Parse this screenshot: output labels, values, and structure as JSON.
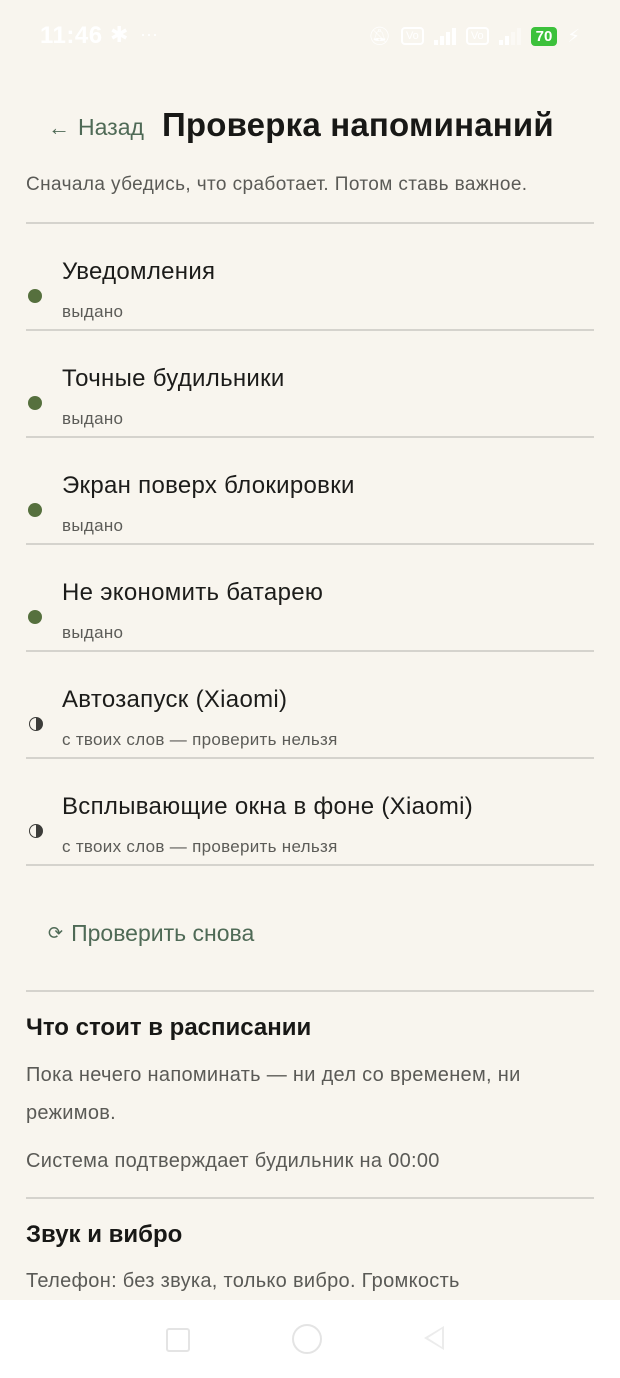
{
  "status_bar": {
    "time": "11:46",
    "battery": "70"
  },
  "header": {
    "back_label": "Назад",
    "title": "Проверка напоминаний",
    "subtitle": "Сначала убедись, что сработает. Потом ставь важное."
  },
  "permissions": [
    {
      "title": "Уведомления",
      "state": "выдано",
      "status": "granted"
    },
    {
      "title": "Точные будильники",
      "state": "выдано",
      "status": "granted"
    },
    {
      "title": "Экран поверх блокировки",
      "state": "выдано",
      "status": "granted"
    },
    {
      "title": "Не экономить батарею",
      "state": "выдано",
      "status": "granted"
    },
    {
      "title": "Автозапуск (Xiaomi)",
      "state": "с твоих слов — проверить нельзя",
      "status": "unverified"
    },
    {
      "title": "Всплывающие окна в фоне (Xiaomi)",
      "state": "с твоих слов — проверить нельзя",
      "status": "unverified"
    }
  ],
  "recheck_label": "Проверить снова",
  "schedule": {
    "title": "Что стоит в расписании",
    "empty_text": "Пока нечего напоминать — ни дел со временем, ни режимов.",
    "alarm_text": "Система подтверждает будильник на 00:00"
  },
  "sound": {
    "title": "Звук и вибро",
    "text": "Телефон: без звука, только вибро. Громкость"
  },
  "colors": {
    "background": "#f8f5ee",
    "accent": "#4f6a56",
    "granted_dot": "#56703e",
    "divider": "#d5d3cd"
  }
}
